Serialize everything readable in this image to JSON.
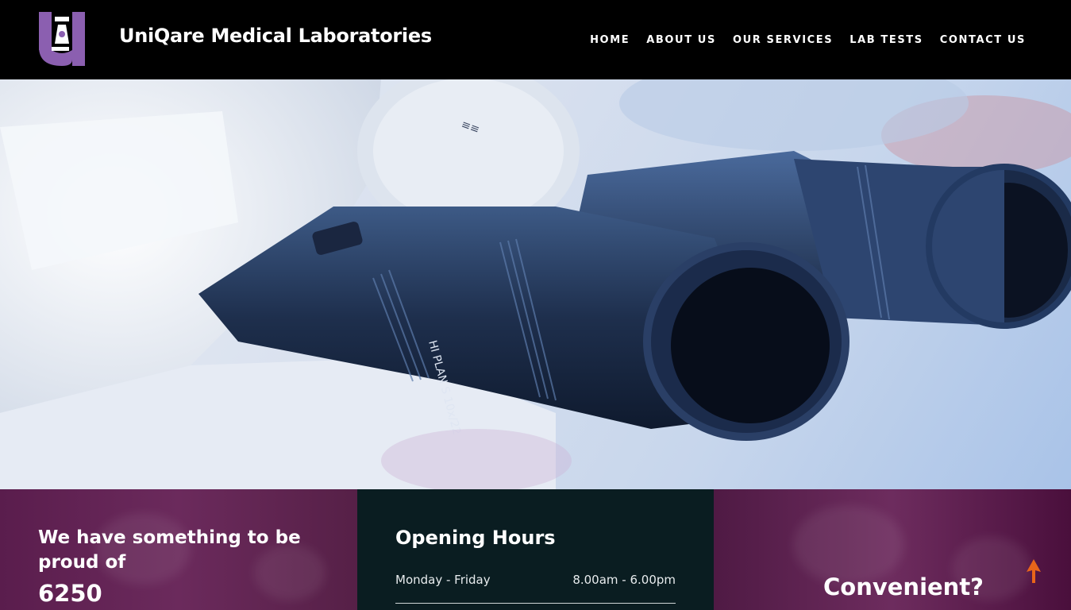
{
  "header": {
    "logo_text": "U",
    "brand": "UniQare Medical Laboratories",
    "nav": [
      "HOME",
      "ABOUT US",
      "OUR SERVICES",
      "LAB TESTS",
      "CONTACT US"
    ]
  },
  "hero": {
    "eyepiece_text": "HI PLAN S 10x/22"
  },
  "stats": {
    "headline": "We have something to be proud of",
    "count": "6250"
  },
  "hours": {
    "title": "Opening Hours",
    "rows": [
      {
        "day": "Monday - Friday",
        "time": "8.00am - 6.00pm"
      }
    ]
  },
  "cta": {
    "question": "Convenient?"
  },
  "colors": {
    "logo_purple": "#8b5fb0",
    "panel_purple": "#6b2a5c",
    "panel_dark": "#0a1d21",
    "scroll_top_orange": "#e8651a"
  },
  "icons": {
    "logo": "microscope-logo-icon",
    "scroll_top": "arrow-up-icon"
  }
}
